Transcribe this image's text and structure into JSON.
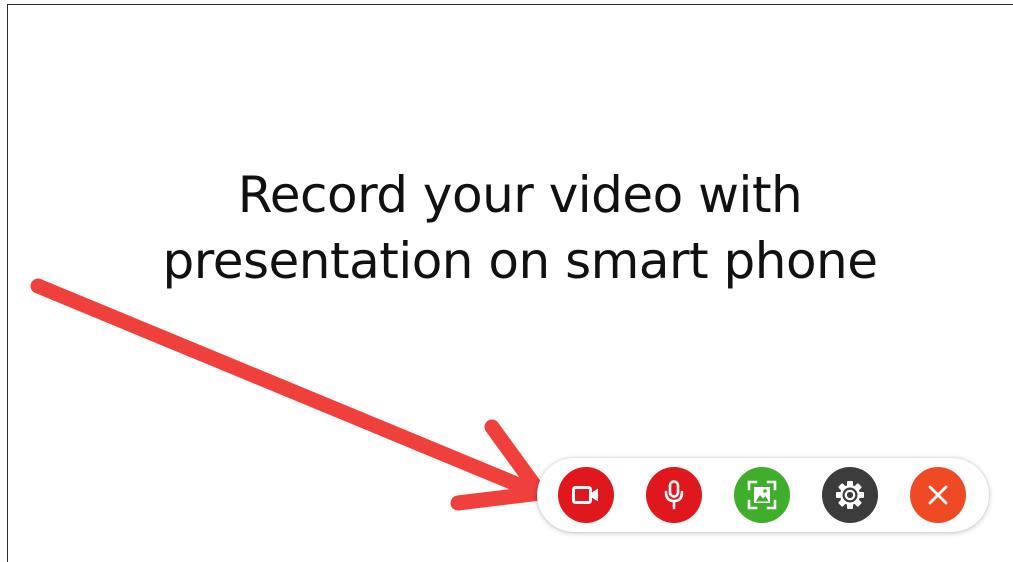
{
  "slide": {
    "title_line1": "Record your video with",
    "title_line2": "presentation on smart phone"
  },
  "colors": {
    "arrow": "#f0403c",
    "record": "#e0171c",
    "mic": "#e0171c",
    "screen": "#3fae2a",
    "settings": "#3c3c3c",
    "close": "#f04a24"
  },
  "toolbar": {
    "buttons": [
      {
        "name": "record-video",
        "icon": "video-camera-icon"
      },
      {
        "name": "microphone",
        "icon": "microphone-icon"
      },
      {
        "name": "screen-share",
        "icon": "image-frame-icon"
      },
      {
        "name": "settings",
        "icon": "gear-icon"
      },
      {
        "name": "close",
        "icon": "close-icon"
      }
    ]
  }
}
